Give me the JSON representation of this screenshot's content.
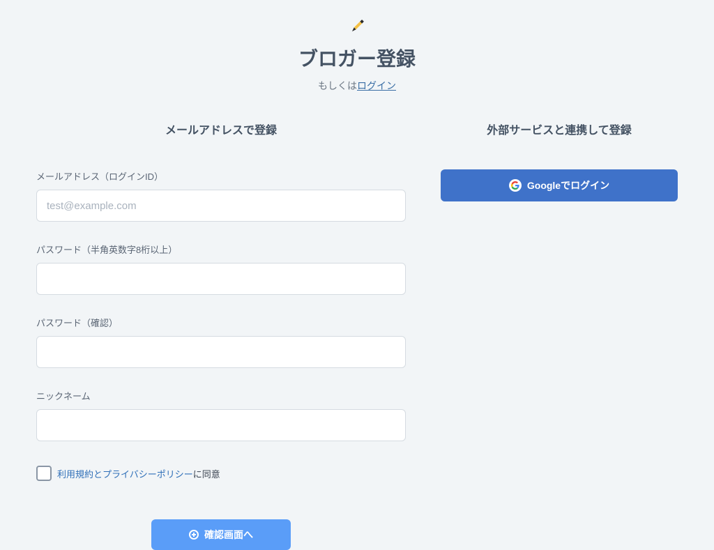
{
  "header": {
    "title": "ブロガー登録",
    "subtitle_prefix": "もしくは",
    "subtitle_link": "ログイン"
  },
  "left": {
    "section_title": "メールアドレスで登録",
    "fields": {
      "email": {
        "label": "メールアドレス（ログインID）",
        "placeholder": "test@example.com"
      },
      "password": {
        "label": "パスワード（半角英数字8桁以上）",
        "placeholder": ""
      },
      "password_confirm": {
        "label": "パスワード（確認）",
        "placeholder": ""
      },
      "nickname": {
        "label": "ニックネーム",
        "placeholder": ""
      }
    },
    "consent": {
      "link_text": "利用規約とプライバシーポリシー",
      "suffix": "に同意"
    },
    "submit_label": "確認画面へ"
  },
  "right": {
    "section_title": "外部サービスと連携して登録",
    "google_label": "Googleでログイン"
  }
}
